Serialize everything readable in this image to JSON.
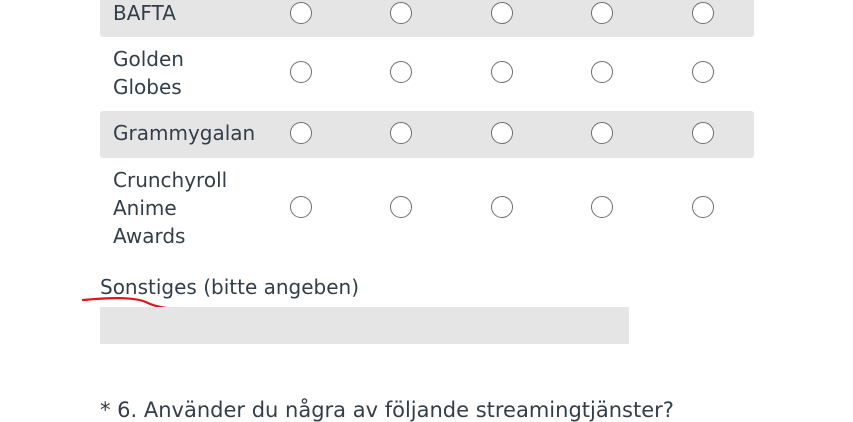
{
  "matrix": {
    "rows": [
      {
        "label_lines": [
          "BAFTA"
        ]
      },
      {
        "label_lines": [
          "Golden",
          "Globes"
        ]
      },
      {
        "label_lines": [
          "Grammygalan"
        ]
      },
      {
        "label_lines": [
          "Crunchyroll",
          "Anime",
          "Awards"
        ]
      }
    ],
    "columns_count": 5
  },
  "other": {
    "label": "Sonstiges (bitte angeben)",
    "value": "",
    "annotation_color": "#e0141b"
  },
  "next_question": {
    "text": "* 6. Använder du några av följande streamingtjänster?"
  },
  "colors": {
    "row_shade": "#e5e5e5",
    "text": "#333e48",
    "radio_border": "#6b7074"
  }
}
